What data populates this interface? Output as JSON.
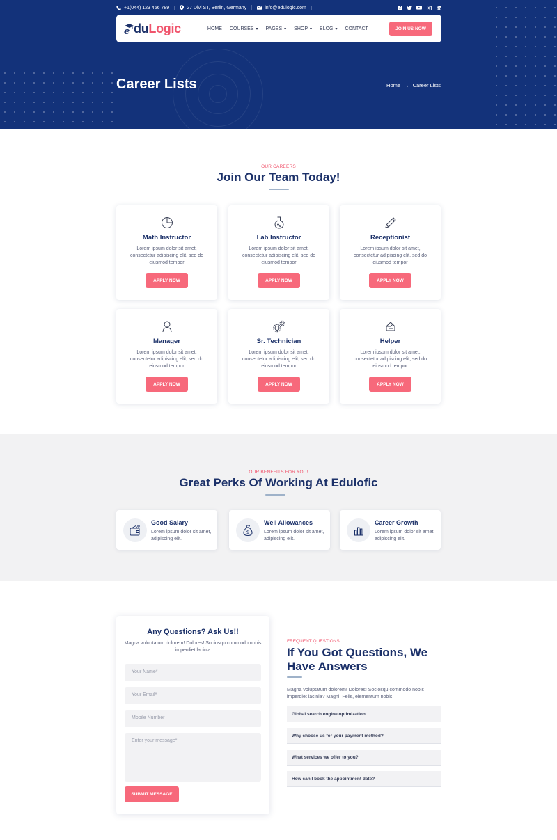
{
  "topbar": {
    "phone": "+1(044) 123 456 789",
    "address": "27 Divi ST, Berlin, Germany",
    "email": "info@edulogic.com"
  },
  "logo": {
    "part1": "du",
    "part2": "Logic"
  },
  "nav": {
    "items": [
      {
        "label": "HOME",
        "dropdown": false
      },
      {
        "label": "COURSES",
        "dropdown": true
      },
      {
        "label": "PAGES",
        "dropdown": true
      },
      {
        "label": "SHOP",
        "dropdown": true
      },
      {
        "label": "BLOG",
        "dropdown": true
      },
      {
        "label": "CONTACT",
        "dropdown": false
      }
    ],
    "join_label": "JOIN US NOW"
  },
  "hero": {
    "title": "Career Lists",
    "breadcrumb_home": "Home",
    "breadcrumb_sep": "→",
    "breadcrumb_current": "Career Lists"
  },
  "careers": {
    "eyebrow": "OUR CAREERS",
    "title": "Join Our Team Today!",
    "apply_label": "APPLY NOW",
    "cards": [
      {
        "title": "Math Instructor",
        "icon": "pie-chart-icon",
        "desc": "Lorem ipsum dolor sit amet, consectetur adipiscing elit, sed do eiusmod tempor"
      },
      {
        "title": "Lab Instructor",
        "icon": "flask-icon",
        "desc": "Lorem ipsum dolor sit amet, consectetur adipiscing elit, sed do eiusmod tempor"
      },
      {
        "title": "Receptionist",
        "icon": "pencil-icon",
        "desc": "Lorem ipsum dolor sit amet, consectetur adipiscing elit, sed do eiusmod tempor"
      },
      {
        "title": "Manager",
        "icon": "user-icon",
        "desc": "Lorem ipsum dolor sit amet, consectetur adipiscing elit, sed do eiusmod tempor"
      },
      {
        "title": "Sr. Technician",
        "icon": "gears-icon",
        "desc": "Lorem ipsum dolor sit amet, consectetur adipiscing elit, sed do eiusmod tempor"
      },
      {
        "title": "Helper",
        "icon": "eraser-icon",
        "desc": "Lorem ipsum dolor sit amet, consectetur adipiscing elit, sed do eiusmod tempor"
      }
    ]
  },
  "perks": {
    "eyebrow": "OUR BENEFITS FOR YOU!",
    "title": "Great Perks Of Working At Edulofic",
    "items": [
      {
        "title": "Good Salary",
        "icon": "wallet-icon",
        "desc": "Lorem ipsum dolor sit amet, adipiscing elit."
      },
      {
        "title": "Well Allowances",
        "icon": "money-bag-icon",
        "desc": "Lorem ipsum dolor sit amet, adipiscing elit."
      },
      {
        "title": "Career Growth",
        "icon": "bar-chart-icon",
        "desc": "Lorem ipsum dolor sit amet, adipiscing elit."
      }
    ]
  },
  "form": {
    "title": "Any Questions? Ask Us!!",
    "subtitle": "Magna voluptatum dolorem! Dolores! Sociosqu commodo nobis imperdiet lacinia",
    "name_placeholder": "Your Name*",
    "email_placeholder": "Your Email*",
    "mobile_placeholder": "Mobile Number",
    "message_placeholder": "Enter your message*",
    "submit_label": "SUBMIT MESSAGE"
  },
  "faq": {
    "eyebrow": "FREQUENT QUESTIONS",
    "title": "If You Got Questions, We Have Answers",
    "text": "Magna voluptatum dolorem! Dolores! Sociosqu commodo nobis imperdiet lacinia? Magni! Felis, elementum nobis.",
    "questions": [
      "Global search engine optimization",
      "Why choose us for your payment method?",
      "What services we offer to you?",
      "How can I book the appointment date?"
    ]
  },
  "colors": {
    "navy": "#13327a",
    "heading": "#1c3169",
    "accent": "#f7697b",
    "perks_bg": "#f2f2f3"
  }
}
